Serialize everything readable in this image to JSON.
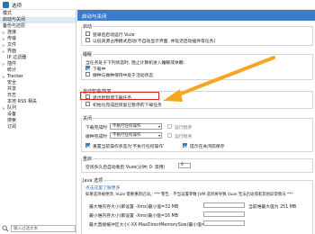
{
  "window": {
    "title": "选项",
    "icon": "vuze-app-icon"
  },
  "sidebar": {
    "items": [
      {
        "label": "模式",
        "expandable": false,
        "selected": false
      },
      {
        "label": "启动与关闭",
        "expandable": false,
        "selected": true
      },
      {
        "label": "备份与还原",
        "expandable": false,
        "selected": false
      },
      {
        "label": "连接",
        "expandable": true,
        "selected": false
      },
      {
        "label": "传输",
        "expandable": true,
        "selected": false
      },
      {
        "label": "文件",
        "expandable": true,
        "selected": false
      },
      {
        "label": "界面",
        "expandable": true,
        "selected": false
      },
      {
        "label": "IP 过滤器",
        "expandable": false,
        "selected": false
      },
      {
        "label": "插件",
        "expandable": true,
        "selected": false
      },
      {
        "label": "统计",
        "expandable": false,
        "selected": false
      },
      {
        "label": "Tracker",
        "expandable": true,
        "selected": false
      },
      {
        "label": "安全",
        "expandable": false,
        "selected": false
      },
      {
        "label": "共享",
        "expandable": false,
        "selected": false
      },
      {
        "label": "日志",
        "expandable": false,
        "selected": false
      },
      {
        "label": "本地 RSS 相关",
        "expandable": false,
        "selected": false
      },
      {
        "label": "队列",
        "expandable": true,
        "selected": false
      },
      {
        "label": "设备",
        "expandable": false,
        "selected": false
      },
      {
        "label": "搜索",
        "expandable": false,
        "selected": false
      },
      {
        "label": "订阅",
        "expandable": false,
        "selected": false
      }
    ],
    "search_placeholder": "输入过滤文本"
  },
  "header": {
    "title": "启动与关闭"
  },
  "sections": {
    "startup": {
      "title": "启动",
      "options": [
        {
          "label": "登录后启动运行 Vuze",
          "checked": false
        },
        {
          "label": "以低资源占用模式启动(不自动显示界面, 并延迟启动插件等任务)",
          "checked": false
        }
      ]
    },
    "sleep": {
      "title": "睡眠",
      "desc": "当任务处于下列状态时, 阻止计算机进入睡眠或休眠:",
      "options": [
        {
          "label": "下载中",
          "checked": true
        },
        {
          "label": "做种与做种保持中处于活动状态",
          "checked": false
        }
      ]
    },
    "pause": {
      "title": "自动暂停/恢复",
      "options": [
        {
          "label": "退出时暂停下载任务",
          "checked": false
        },
        {
          "label": "初始化完成后恢复已暂停的下载任务",
          "checked": false
        }
      ]
    },
    "shutdown": {
      "title": "关闭",
      "rows": [
        {
          "label": "下载完成时",
          "value": "不执行任何操作",
          "extra": "运行程序"
        },
        {
          "label": "做种完成时",
          "value": "不执行任何操作",
          "extra": "运行程序"
        }
      ],
      "options": [
        {
          "label": "重置当前操作状态为'不执行任何操作'",
          "checked": true
        },
        {
          "label": "提示在关闭前保存",
          "checked": true
        }
      ]
    },
    "restart": {
      "title": "重启",
      "desc": "空闲多久后自动重启 Vuze(分钟; 0: 禁用)",
      "value": "0"
    },
    "java": {
      "title": "Java 选项",
      "link": "点击这里了解更多",
      "desc": "如果选项被更改, Vuze 需要重新启动。*** 警告 - 不当设置参数 JVM 选项将导致 Vuze 无法启动或者其他异常情况 ***",
      "rows": [
        {
          "label": "最大堆内存大小(即设置 -Xmx)最小值=32 MB",
          "value": "",
          "note": "当前堆最大值为 251 MB"
        },
        {
          "label": "最小堆内存大小(即设置 -Xms)最小值=16 MB",
          "value": "",
          "note": ""
        },
        {
          "label": "最大直接缓冲区大小(-XX:MaxDirectMemorySize)最小值=...",
          "value": "",
          "note": ""
        }
      ]
    }
  },
  "annotation": {
    "arrow_color": "#f5a623",
    "highlight_color": "#e02020"
  },
  "colors": {
    "accent": "#3b7dcc",
    "selected_bg": "#dce9f7"
  }
}
